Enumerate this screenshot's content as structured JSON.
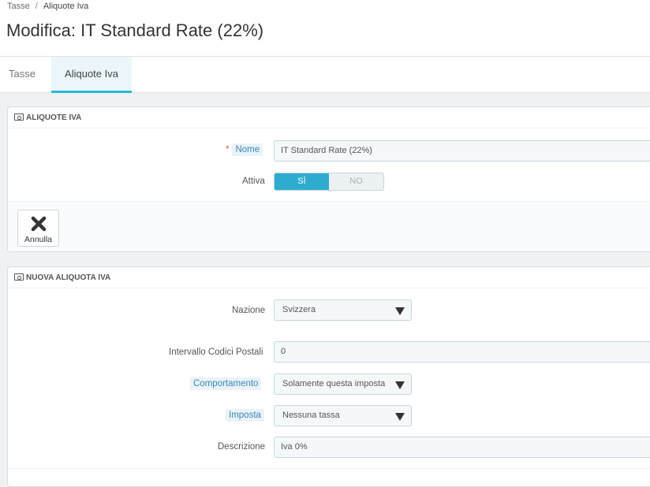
{
  "breadcrumb": {
    "parent": "Tasse",
    "separator": "/",
    "current": "Aliquote Iva"
  },
  "page_title": "Modifica: IT Standard Rate (22%)",
  "tabs": [
    {
      "label": "Tasse",
      "active": false
    },
    {
      "label": "Aliquote Iva",
      "active": true
    }
  ],
  "panel_rate": {
    "heading": "ALIQUOTE IVA",
    "name_required_mark": "*",
    "name_label": "Nome",
    "name_value": "IT Standard Rate (22%)",
    "active_label": "Attiva",
    "switch_yes": "SÌ",
    "switch_no": "NO",
    "switch_value": "SÌ",
    "cancel_label": "Annulla"
  },
  "panel_new": {
    "heading": "NUOVA ALIQUOTA IVA",
    "country_label": "Nazione",
    "country_value": "Svizzera",
    "zip_label": "Intervallo Codici Postali",
    "zip_value": "0",
    "behavior_label": "Comportamento",
    "behavior_value": "Solamente questa imposta",
    "tax_label": "Imposta",
    "tax_value": "Nessuna tassa",
    "description_label": "Descrizione",
    "description_value": "Iva 0%"
  },
  "colors": {
    "accent": "#25b9d7",
    "switch_on": "#2eacce",
    "required": "#e14b3b",
    "hint_text": "#3b87b8"
  }
}
